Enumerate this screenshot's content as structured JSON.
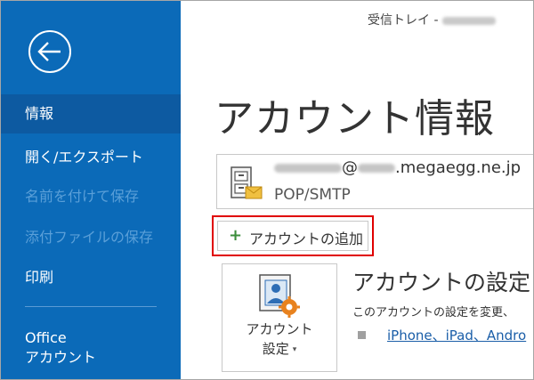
{
  "sidebar": {
    "items": [
      {
        "label": "情報",
        "selected": true,
        "enabled": true
      },
      {
        "label": "開く/エクスポート",
        "enabled": true
      },
      {
        "label": "名前を付けて保存",
        "enabled": false
      },
      {
        "label": "添付ファイルの保存",
        "enabled": false
      },
      {
        "label": "印刷",
        "enabled": true
      }
    ],
    "office_account": {
      "line1": "Office",
      "line2": "アカウント"
    }
  },
  "titlebar": {
    "text": "受信トレイ -"
  },
  "page_title": "アカウント情報",
  "account": {
    "email_domain": "@",
    "email_suffix": ".megaegg.ne.jp",
    "type": "POP/SMTP"
  },
  "add_account_label": "アカウントの追加",
  "settings": {
    "tile_label_line1": "アカウント",
    "tile_label_line2": "設定",
    "caret": "▾",
    "heading": "アカウントの設定",
    "description": "このアカウントの設定を変更、",
    "link_text": "iPhone、iPad、Andro"
  },
  "colors": {
    "sidebar_bg": "#0b6ab8",
    "sidebar_selected": "#0d5aa1",
    "highlight_border": "#e00000",
    "link": "#1a5ea8"
  },
  "icons": [
    "back-arrow-icon",
    "account-cabinet-icon",
    "plus-icon",
    "account-settings-icon",
    "bullet-icon"
  ]
}
